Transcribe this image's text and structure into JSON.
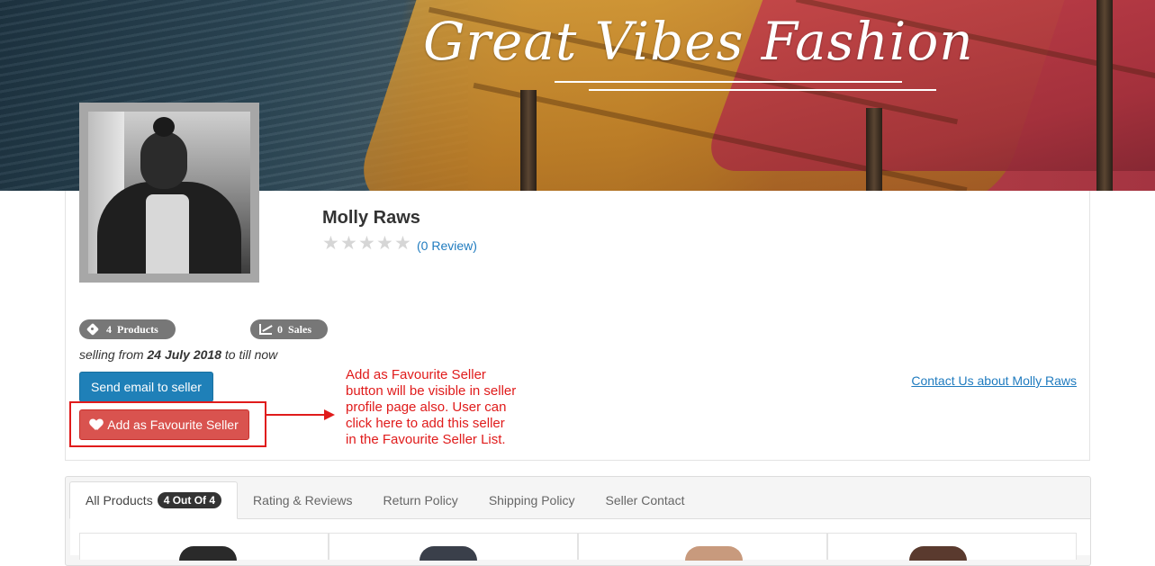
{
  "banner": {
    "store_title": "Great Vibes Fashion"
  },
  "seller": {
    "name": "Molly Raws",
    "rating_stars": 0,
    "review_link": "(0 Review)",
    "products_count": "4",
    "products_label": "Products",
    "sales_count": "0",
    "sales_label": "Sales",
    "selling_prefix": "selling from",
    "selling_date": "24 July 2018",
    "selling_suffix": "to till now",
    "send_email_label": "Send email to seller",
    "favourite_label": "Add as Favourite Seller",
    "contact_link": "Contact Us about Molly Raws"
  },
  "annotation": {
    "text": "Add as Favourite Seller button will be visible in seller profile page also. User can click here to add this seller in the Favourite Seller List.",
    "color": "#e01b1b"
  },
  "tabs": [
    {
      "label": "All Products",
      "badge": "4 Out Of 4",
      "active": true
    },
    {
      "label": "Rating & Reviews"
    },
    {
      "label": "Return Policy"
    },
    {
      "label": "Shipping Policy"
    },
    {
      "label": "Seller Contact"
    }
  ],
  "colors": {
    "email_button": "#1f80b8",
    "favourite_button": "#d9534f",
    "link": "#1f7bbf",
    "pill": "#777777"
  }
}
